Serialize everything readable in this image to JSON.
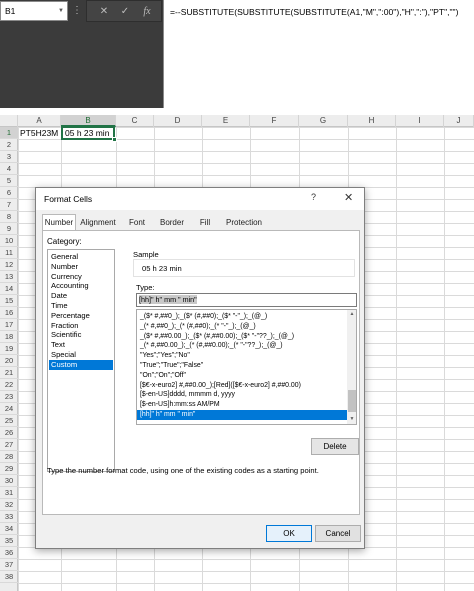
{
  "formula_bar": {
    "name_box": "B1",
    "cancel_icon": "close-icon",
    "enter_icon": "check-icon",
    "function_label": "fx",
    "formula": "=--SUBSTITUTE(SUBSTITUTE(SUBSTITUTE(A1,\"M\",\":00\"),\"H\",\":\"),\"PT\",\"\")"
  },
  "sheet": {
    "columns": [
      "A",
      "B",
      "C",
      "D",
      "E",
      "F",
      "G",
      "H",
      "I",
      "J"
    ],
    "selected_column": "B",
    "rows": [
      "1",
      "2",
      "3",
      "4",
      "5",
      "6",
      "7",
      "8",
      "9",
      "10",
      "11",
      "12",
      "13",
      "14",
      "15",
      "16",
      "17",
      "18",
      "19",
      "20",
      "21",
      "22",
      "23",
      "24",
      "25",
      "26",
      "27",
      "28",
      "29",
      "30",
      "31",
      "32",
      "33",
      "34",
      "35",
      "36",
      "37",
      "38"
    ],
    "selected_row": "1",
    "cell_a1": "PT5H23M",
    "cell_b1": "05 h 23  min"
  },
  "dialog": {
    "title": "Format Cells",
    "help": "?",
    "close": "✕",
    "tabs": [
      "Number",
      "Alignment",
      "Font",
      "Border",
      "Fill",
      "Protection"
    ],
    "active_tab": "Number",
    "category_label": "Category:",
    "categories": [
      "General",
      "Number",
      "Currency",
      "Accounting",
      "Date",
      "Time",
      "Percentage",
      "Fraction",
      "Scientific",
      "Text",
      "Special",
      "Custom"
    ],
    "selected_category": "Custom",
    "sample_label": "Sample",
    "sample_value": "05 h 23  min",
    "type_label": "Type:",
    "type_value": "[hh]\" h\" mm \" min\"",
    "formats": [
      "_($* #,##0_);_($* (#,##0);_($* \"-\"_);_(@_)",
      "_(* #,##0_);_(* (#,##0);_(* \"-\"_);_(@_)",
      "_($* #,##0.00_);_($* (#,##0.00);_($* \"-\"??_);_(@_)",
      "_(* #,##0.00_);_(* (#,##0.00);_(* \"-\"??_);_(@_)",
      "\"Yes\";\"Yes\";\"No\"",
      "\"True\";\"True\";\"False\"",
      "\"On\";\"On\";\"Off\"",
      "[$€-x-euro2] #,##0.00_);[Red]([$€-x-euro2] #,##0.00)",
      "[$-en-US]dddd, mmmm d, yyyy",
      "[$-en-US]h:mm:ss AM/PM",
      "[hh]\" h\" mm \" min\""
    ],
    "selected_format_index": 10,
    "delete_label": "Delete",
    "hint": "Type the number format code, using one of the existing codes as a starting point.",
    "ok_label": "OK",
    "cancel_label": "Cancel"
  },
  "colors": {
    "selection": "#0078d7",
    "excel_green": "#217346",
    "chrome": "#3b3b3b"
  }
}
